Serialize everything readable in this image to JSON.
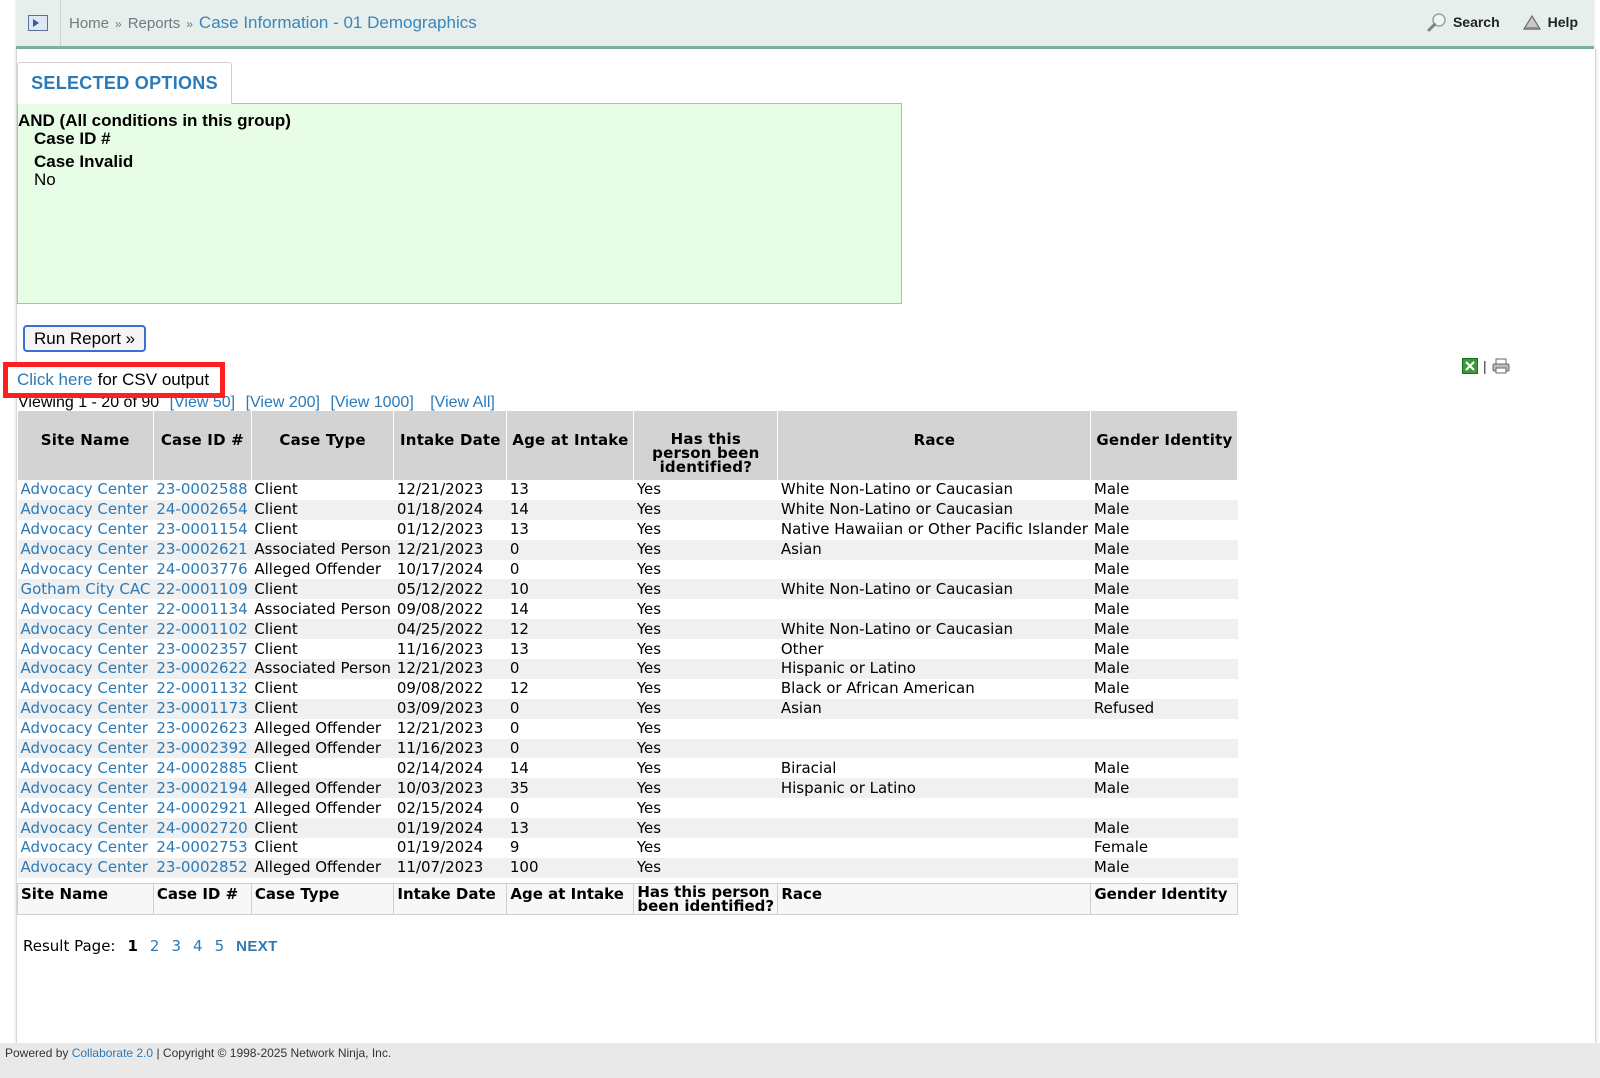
{
  "header": {
    "breadcrumb": {
      "home": "Home",
      "separator": "»",
      "reports": "Reports",
      "current": "Case Information - 01 Demographics"
    },
    "search_label": "Search",
    "help_label": "Help",
    "icons": {
      "menu": "menu-toggle-icon",
      "search": "magnifier-icon",
      "help": "life-buoy-icon"
    }
  },
  "selected_options": {
    "tab_label": "SELECTED OPTIONS",
    "group_title": "AND (All conditions in this group)",
    "conditions": [
      {
        "label": "Case ID #",
        "value": ""
      },
      {
        "label": "Case Invalid",
        "value": "No"
      }
    ]
  },
  "run_report_label": "Run Report »",
  "csv": {
    "link_text": "Click here",
    "rest_text": "for CSV output"
  },
  "view_links": {
    "viewing_text": "Viewing 1 - 20 of 90",
    "links": [
      "[View 50]",
      "[View 200]",
      "[View 1000]",
      "[View All]"
    ]
  },
  "export": {
    "excel_icon": "excel-icon",
    "separator": "|",
    "print_icon": "printer-icon"
  },
  "table": {
    "columns": [
      "Site Name",
      "Case ID #",
      "Case Type",
      "Intake Date",
      "Age at Intake",
      "Has this person been identified?",
      "Race",
      "Gender Identity"
    ],
    "rows": [
      [
        "Advocacy Center",
        "23-0002588",
        "Client",
        "12/21/2023",
        "13",
        "Yes",
        "White Non-Latino or Caucasian",
        "Male"
      ],
      [
        "Advocacy Center",
        "24-0002654",
        "Client",
        "01/18/2024",
        "14",
        "Yes",
        "White Non-Latino or Caucasian",
        "Male"
      ],
      [
        "Advocacy Center",
        "23-0001154",
        "Client",
        "01/12/2023",
        "13",
        "Yes",
        "Native Hawaiian or Other Pacific Islander",
        "Male"
      ],
      [
        "Advocacy Center",
        "23-0002621",
        "Associated Person",
        "12/21/2023",
        "0",
        "Yes",
        "Asian",
        "Male"
      ],
      [
        "Advocacy Center",
        "24-0003776",
        "Alleged Offender",
        "10/17/2024",
        "0",
        "Yes",
        "",
        "Male"
      ],
      [
        "Gotham City CAC",
        "22-0001109",
        "Client",
        "05/12/2022",
        "10",
        "Yes",
        "White Non-Latino or Caucasian",
        "Male"
      ],
      [
        "Advocacy Center",
        "22-0001134",
        "Associated Person",
        "09/08/2022",
        "14",
        "Yes",
        "",
        "Male"
      ],
      [
        "Advocacy Center",
        "22-0001102",
        "Client",
        "04/25/2022",
        "12",
        "Yes",
        "White Non-Latino or Caucasian",
        "Male"
      ],
      [
        "Advocacy Center",
        "23-0002357",
        "Client",
        "11/16/2023",
        "13",
        "Yes",
        "Other",
        "Male"
      ],
      [
        "Advocacy Center",
        "23-0002622",
        "Associated Person",
        "12/21/2023",
        "0",
        "Yes",
        "Hispanic or Latino",
        "Male"
      ],
      [
        "Advocacy Center",
        "22-0001132",
        "Client",
        "09/08/2022",
        "12",
        "Yes",
        "Black or African American",
        "Male"
      ],
      [
        "Advocacy Center",
        "23-0001173",
        "Client",
        "03/09/2023",
        "0",
        "Yes",
        "Asian",
        "Refused"
      ],
      [
        "Advocacy Center",
        "23-0002623",
        "Alleged Offender",
        "12/21/2023",
        "0",
        "Yes",
        "",
        ""
      ],
      [
        "Advocacy Center",
        "23-0002392",
        "Alleged Offender",
        "11/16/2023",
        "0",
        "Yes",
        "",
        ""
      ],
      [
        "Advocacy Center",
        "24-0002885",
        "Client",
        "02/14/2024",
        "14",
        "Yes",
        "Biracial",
        "Male"
      ],
      [
        "Advocacy Center",
        "23-0002194",
        "Alleged Offender",
        "10/03/2023",
        "35",
        "Yes",
        "Hispanic or Latino",
        "Male"
      ],
      [
        "Advocacy Center",
        "24-0002921",
        "Alleged Offender",
        "02/15/2024",
        "0",
        "Yes",
        "",
        ""
      ],
      [
        "Advocacy Center",
        "24-0002720",
        "Client",
        "01/19/2024",
        "13",
        "Yes",
        "",
        "Male"
      ],
      [
        "Advocacy Center",
        "24-0002753",
        "Client",
        "01/19/2024",
        "9",
        "Yes",
        "",
        "Female"
      ],
      [
        "Advocacy Center",
        "23-0002852",
        "Alleged Offender",
        "11/07/2023",
        "100",
        "Yes",
        "",
        "Male"
      ]
    ]
  },
  "pagination": {
    "label": "Result Page:",
    "current": "1",
    "pages": [
      "2",
      "3",
      "4",
      "5"
    ],
    "next": "NEXT"
  },
  "footer": {
    "powered_by": "Powered by",
    "product": "Collaborate 2.0",
    "copyright": "| Copyright © 1998-2025 Network Ninja, Inc."
  },
  "colors": {
    "link": "#2a7ab8",
    "callout": "#ff1f1f",
    "options_bg": "#e8fde6",
    "header_accent": "#7fb29d"
  }
}
